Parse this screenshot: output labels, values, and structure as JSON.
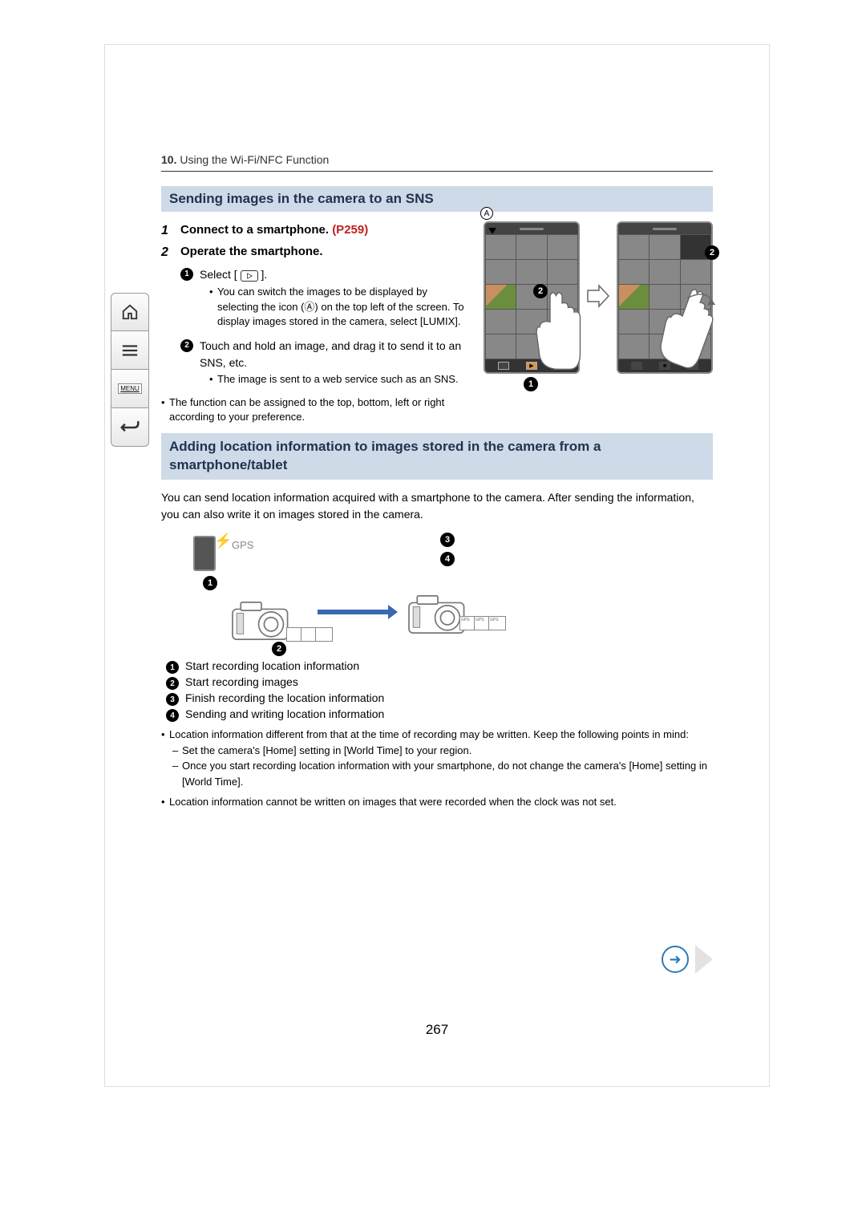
{
  "chapter": {
    "number": "10.",
    "title": "Using the Wi-Fi/NFC Function"
  },
  "nav": {
    "home": "⌂",
    "list": "≡",
    "menu": "MENU",
    "back": "↩"
  },
  "section1": {
    "heading": "Sending images in the camera to an SNS",
    "step1_num": "1",
    "step1_text": "Connect to a smartphone. ",
    "step1_link": "(P259)",
    "step2_num": "2",
    "step2_text": "Operate the smartphone.",
    "sub1_text_a": "Select [ ",
    "sub1_text_b": " ].",
    "sub1_note": "You can switch the images to be displayed by selecting the icon (Ⓐ) on the top left of the screen. To display images stored in the camera, select [LUMIX].",
    "sub2_text": "Touch and hold an image, and drag it to send it to an SNS, etc.",
    "sub2_note": "The image is sent to a web service such as an SNS.",
    "main_note": "The function can be assigned to the top, bottom, left or right according to your preference.",
    "callouts": {
      "letterA": "A",
      "c1": "1",
      "c2": "2"
    }
  },
  "section2": {
    "heading": "Adding location information to images stored in the camera from a smartphone/tablet",
    "intro": "You can send location information acquired with a smartphone to the camera. After sending the information, you can also write it on images stored in the camera.",
    "gps_label": "GPS",
    "callouts": {
      "c1": "1",
      "c2": "2",
      "c3": "3",
      "c4": "4"
    },
    "legend": {
      "l1": "Start recording location information",
      "l2": "Start recording images",
      "l3": "Finish recording the location information",
      "l4": "Sending and writing location information"
    },
    "note1": "Location information different from that at the time of recording may be written. Keep the following points in mind:",
    "note1a": "Set the camera's [Home] setting in [World Time] to your region.",
    "note1b": "Once you start recording location information with your smartphone, do not change the camera's [Home] setting in [World Time].",
    "note2": "Location information cannot be written on images that were recorded when the clock was not set."
  },
  "page_number": "267"
}
